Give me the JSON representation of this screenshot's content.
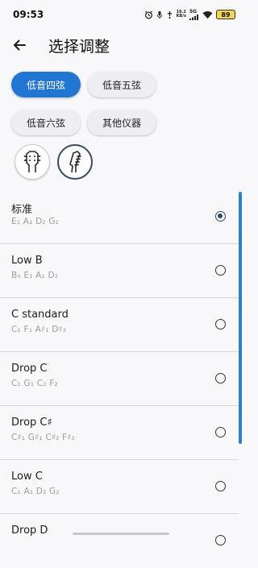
{
  "status_bar": {
    "time": "09:53",
    "net_speed_value": "19.2",
    "net_speed_unit": "KB/s",
    "network_5g": "5G",
    "battery": "89"
  },
  "header": {
    "title": "选择调整",
    "back_icon": "arrow-left-icon"
  },
  "instrument_chips": [
    {
      "label": "低音四弦",
      "selected": true
    },
    {
      "label": "低音五弦",
      "selected": false
    },
    {
      "label": "低音六弦",
      "selected": false
    },
    {
      "label": "其他仪器",
      "selected": false
    }
  ],
  "headstock_buttons": [
    {
      "icon": "headstock-2x2-icon",
      "active": false
    },
    {
      "icon": "headstock-4-inline-icon",
      "active": true
    }
  ],
  "tunings": [
    {
      "name": "标准",
      "notes": "E₁ A₁ D₂ G₂",
      "selected": true
    },
    {
      "name": "Low B",
      "notes": "B₀ E₁ A₁ D₂",
      "selected": false
    },
    {
      "name": "C standard",
      "notes": "C₁ F₁ A♯₁ D♯₂",
      "selected": false
    },
    {
      "name": "Drop C",
      "notes": "C₁ G₁ C₂ F₂",
      "selected": false
    },
    {
      "name": "Drop C♯",
      "notes": "C♯₁ G♯₁ C♯₂ F♯₂",
      "selected": false
    },
    {
      "name": "Low C",
      "notes": "C₁ A₁ D₂ G₂",
      "selected": false
    },
    {
      "name": "Drop D",
      "notes": "",
      "selected": false
    }
  ],
  "colors": {
    "accent": "#2176d4",
    "radio_selected": "#2f4a68",
    "background": "#f8f8fb"
  }
}
